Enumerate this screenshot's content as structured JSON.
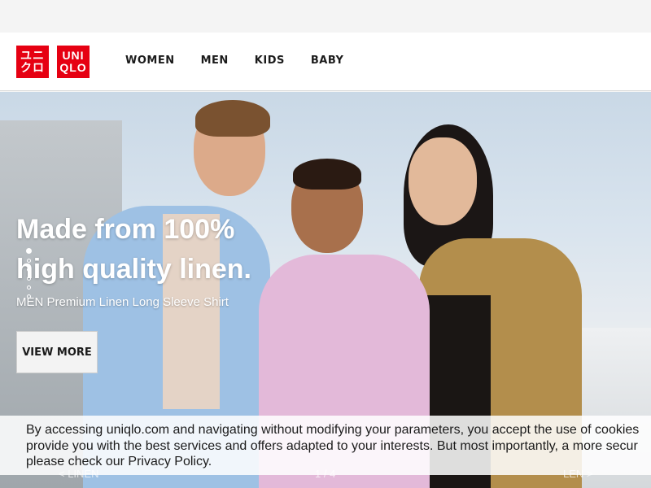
{
  "brand": {
    "logo_katakana": [
      "ユニ",
      "クロ"
    ],
    "logo_latin": [
      "UNI",
      "QLO"
    ],
    "color": "#e60012"
  },
  "nav": {
    "items": [
      "WOMEN",
      "MEN",
      "KIDS",
      "BABY"
    ]
  },
  "hero": {
    "headline_line1": "Made from 100%",
    "headline_line2": "high quality linen.",
    "subline": "MEN Premium Linen Long Sleeve Shirt",
    "cta_label": "VIEW MORE",
    "carousel_dots": 6,
    "carousel_active_index": 0,
    "bottom_nav": {
      "prev": "< LINEN",
      "counter": "1 / 4",
      "next": "LEN >"
    }
  },
  "cookie_banner": {
    "line1": "By accessing uniqlo.com and navigating without modifying your parameters, you accept the use of cookies",
    "line2": "provide you with the best services and offers adapted to your interests. But most importantly, a more secur",
    "line3": "please check our Privacy Policy."
  }
}
